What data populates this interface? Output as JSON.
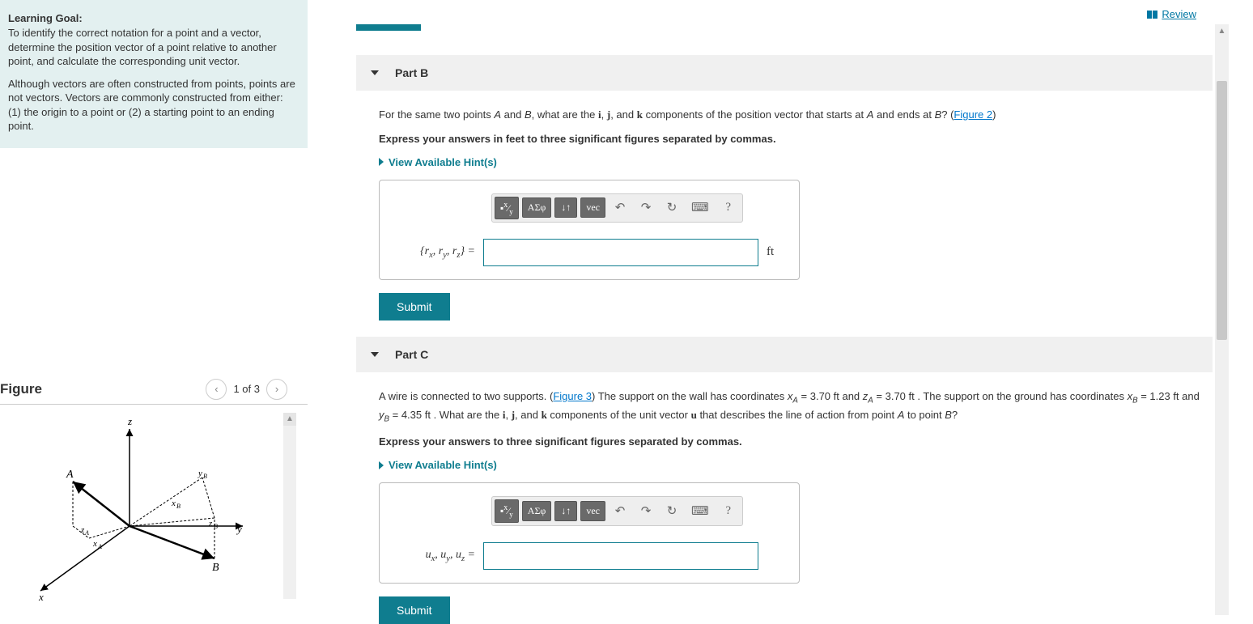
{
  "review_link": "Review",
  "learning_goal": {
    "heading": "Learning Goal:",
    "p1": "To identify the correct notation for a point and a vector, determine the position vector of a point relative to another point, and calculate the corresponding unit vector.",
    "p2": "Although vectors are often constructed from points, points are not vectors. Vectors are commonly constructed from either: (1) the origin to a point or (2) a starting point to an ending point."
  },
  "figure": {
    "title": "Figure",
    "pager_text": "1 of 3",
    "labels": {
      "z": "z",
      "y": "y",
      "x": "x",
      "A": "A",
      "B": "B",
      "xA": "xA",
      "zA": "zA",
      "xB": "xB",
      "yB": "yB",
      "zB": "zB"
    }
  },
  "partB": {
    "title": "Part B",
    "q_prefix": "For the same two points ",
    "q_A": "A",
    "q_and1": " and ",
    "q_B": "B",
    "q_mid1": ", what are the ",
    "q_i": "i",
    "q_comma1": ", ",
    "q_j": "j",
    "q_comma2": ", and ",
    "q_k": "k",
    "q_mid2": " components of the position vector that starts at ",
    "q_A2": "A",
    "q_mid3": " and ends at ",
    "q_B2": "B",
    "q_end": "? (",
    "q_figlink": "Figure 2",
    "q_close": ")",
    "instruct": "Express your answers in feet to three significant figures separated by commas.",
    "hints": "View Available Hint(s)",
    "var_label": "{rₓ, rᵧ, r_z} =",
    "unit": "ft",
    "submit": "Submit"
  },
  "partC": {
    "title": "Part C",
    "q_line": "A wire is connected to two supports. (Figure 3) The support on the wall has coordinates xA = 3.70 ft and zA = 3.70 ft . The support on the ground has coordinates xB = 1.23 ft and yB = 4.35 ft . What are the i, j, and k components of the unit vector u that describes the line of action from point A to point B?",
    "figlink": "Figure 3",
    "instruct": "Express your answers to three significant figures separated by commas.",
    "hints": "View Available Hint(s)",
    "var_label": "uₓ, uᵧ, u_z =",
    "submit": "Submit"
  },
  "toolbar": {
    "templates": "√",
    "greek": "ΑΣφ",
    "subsup": "↓↑",
    "vec": "vec",
    "undo": "↶",
    "redo": "↷",
    "reset": "↻",
    "keyboard": "⌨",
    "help": "?"
  },
  "chart_data": {
    "type": "diagram",
    "description": "3D coordinate axes x, y, z with two labeled points A and B. A is above origin along z with offsets xA, zA. B is out along positive y with offsets xB, yB, zB shown by dashed projection lines.",
    "points": [
      {
        "name": "A",
        "coords_labels": [
          "xA",
          "zA"
        ]
      },
      {
        "name": "B",
        "coords_labels": [
          "xB",
          "yB",
          "zB"
        ]
      }
    ],
    "axes": [
      "x",
      "y",
      "z"
    ]
  }
}
